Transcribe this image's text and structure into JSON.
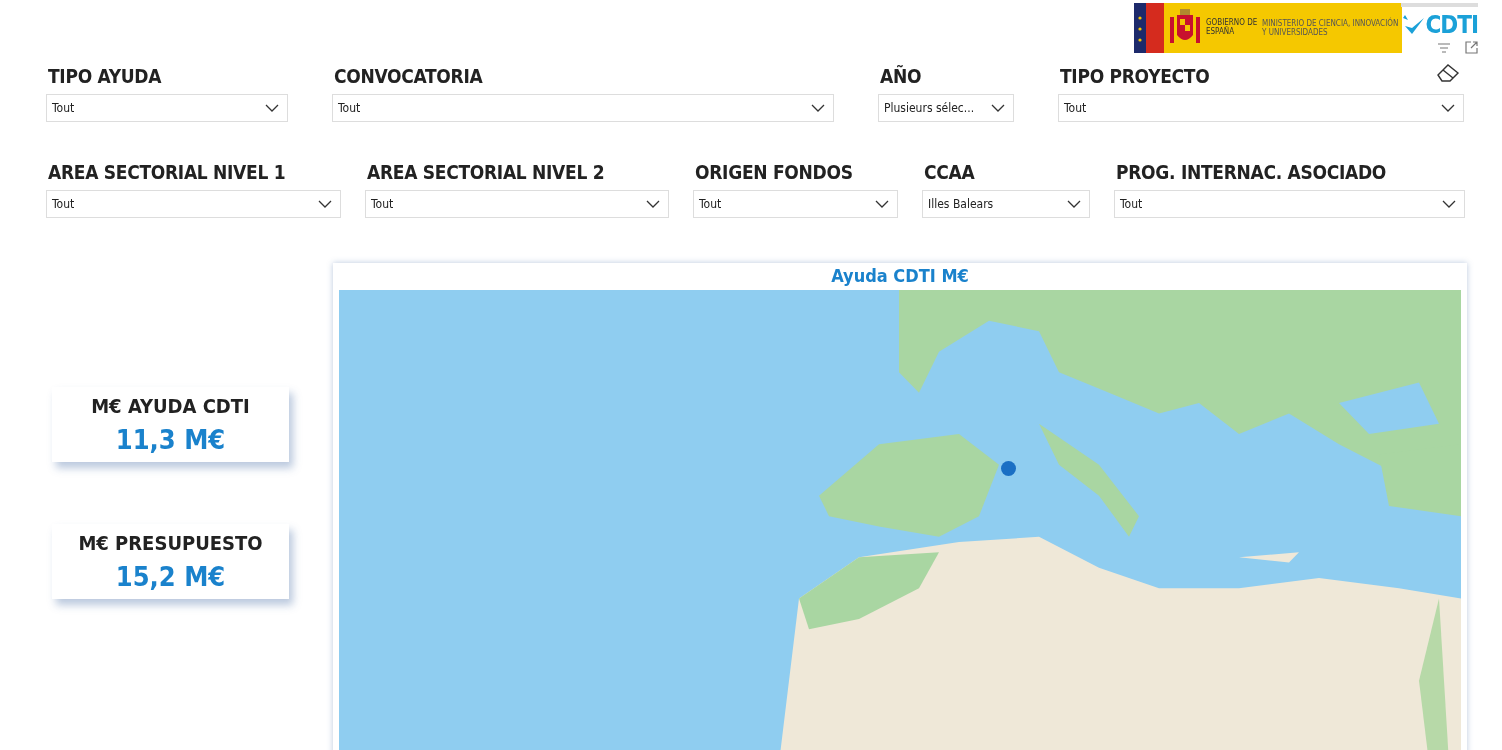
{
  "header": {
    "logo_gov": "GOBIERNO DE ESPAÑA",
    "logo_ministry": "MINISTERIO DE CIENCIA, INNOVACIÓN Y UNIVERSIDADES",
    "logo_cdti": "CDTI"
  },
  "filter_rows": [
    [
      {
        "label": "TIPO AYUDA",
        "value": "Tout"
      },
      {
        "label": "CONVOCATORIA",
        "value": "Tout"
      },
      {
        "label": "AÑO",
        "value": "Plusieurs sélec..."
      },
      {
        "label": "TIPO PROYECTO",
        "value": "Tout"
      }
    ],
    [
      {
        "label": "AREA SECTORIAL NIVEL 1",
        "value": "Tout"
      },
      {
        "label": "AREA SECTORIAL NIVEL 2",
        "value": "Tout"
      },
      {
        "label": "ORIGEN FONDOS",
        "value": "Tout"
      },
      {
        "label": "CCAA",
        "value": "Illes Balears"
      },
      {
        "label": "PROG. INTERNAC. ASOCIADO",
        "value": "Tout"
      }
    ]
  ],
  "kpis": [
    {
      "label": "M€ AYUDA CDTI",
      "value": "11,3 M€"
    },
    {
      "label": "M€ PRESUPUESTO",
      "value": "15,2 M€"
    }
  ],
  "map": {
    "title": "Ayuda CDTI M€",
    "kind": "picture"
  }
}
